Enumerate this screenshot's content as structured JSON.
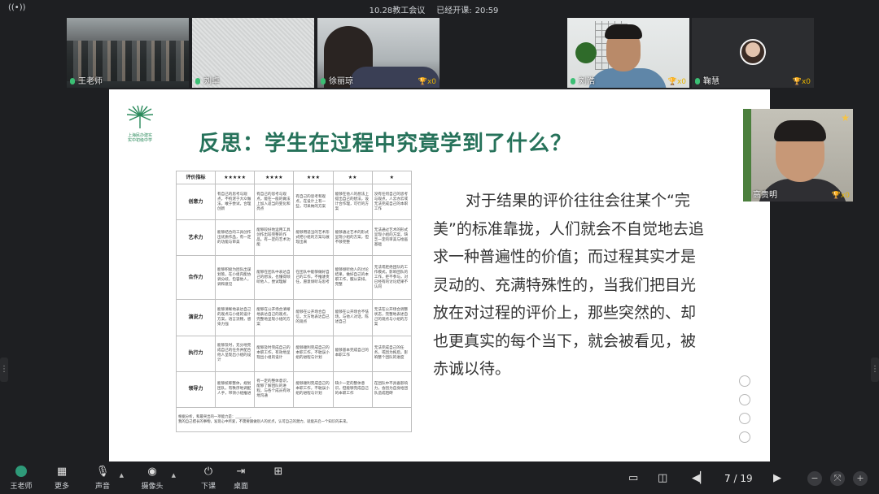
{
  "topbar": {
    "signal_icon": "((•))",
    "meeting_title": "10.28教工会议",
    "status_label": "已经开课:",
    "elapsed": "20:59"
  },
  "tiles": [
    {
      "name": "王老师",
      "cup": ""
    },
    {
      "name": "刘卓",
      "cup": ""
    },
    {
      "name": "徐丽琼",
      "cup": "🏆x0"
    },
    {
      "name": "刘浩",
      "cup": "🏆x0"
    },
    {
      "name": "鞠慧",
      "cup": "🏆x0"
    }
  ],
  "self_video": {
    "name": "高贵明",
    "cup": "🏆x0",
    "star": "★"
  },
  "slide": {
    "logo_text": [
      "上海民办建实",
      "实中初级中学"
    ],
    "heading": "反思：学生在过程中究竟学到了什么？",
    "rubric": {
      "headers": [
        "评价指标",
        "★★★★★",
        "★★★★",
        "★★★",
        "★★",
        "★"
      ],
      "rows": [
        {
          "dim": "创意力",
          "cells": [
            "有自己的思考与观点，不拘泥于大众做法，敢于尝试，合理创新",
            "有自己的思考与观点，能在一般的做法上加入适当的变化和亮点",
            "有自己的思考和观点，在设计上有一些，可采纳的方案",
            "能够在他人的想法上提出自己的想法，设计合作理，可行的方案",
            "没有任何自己的思考与观点，人云亦云或无法完成自己的本职工作"
          ]
        },
        {
          "dim": "艺术力",
          "cells": [
            "能够结合的工具创作出优质作品，有一定的功能与审美",
            "能够较好地运用工具创作出较完整的作品，有一定的艺术功能",
            "能够用适当的艺术形式把小组的方案与展现出来",
            "能够通过艺术的形式呈现小组的方案，但不够完整",
            "无法通过艺术的形式呈现小组的方案，缺乏一定的审美与绘画基础"
          ]
        },
        {
          "dim": "合作力",
          "cells": [
            "能够积极为团队出谋划策，在小组内能协调分歧，包容他人，调和意见",
            "能够在团队中表达自己的想法，也懂得倾听他人，尝试理解",
            "在团队中能够做好自己的工作，不推诿责任，愿意倾听与思考",
            "能够倾听他人的讨论结果，做好自己的本职工作，服从安排，完整",
            "无法或拒绝团队的工作模式，影响团队的工作，拒不参与，对已经有的讨论结果不认同"
          ]
        },
        {
          "dim": "演说力",
          "cells": [
            "能够清晰地表达自己的观点与小组的设计方案，语言流畅，感染力强",
            "能够在公开场合清晰地表达自己的观点，完整地呈现小组的方案",
            "能够在公开场合自信，大方地表达自己的观点",
            "能够在公开场合不怯场，与他人对话，陈述自己",
            "无法在公开场合调整状态，完整地表述自己的观点与小组的方案"
          ]
        },
        {
          "dim": "执行力",
          "cells": [
            "能够及时，充分地完成自己的任务并配合他人呈现出小组的设计",
            "能够及时完成自己的本职工作，有效地呈现出小组的设计",
            "能够顺利完成自己的本职工作，不耽误小组的进程与计划",
            "能够基本完成自己的本职工作",
            "无法完成自己的任务，或因为拖后，影响整个团队的进度"
          ]
        },
        {
          "dim": "领导力",
          "cells": [
            "能够统筹整体，规划团队，有秩序地调配人手，带领小组推进",
            "有一定的整体意识，能够了解团队的进程，与各个成员有效地沟通",
            "能够顺利完成自己的本职工作，不耽误小组的进程与计划",
            "缺少一定的整体意识，但能够完成自己的本职工作",
            "在团队中不具备影响力，会因为自身给团队造成阻碍"
          ]
        }
      ],
      "footer": [
        "根据分析，和最突出的一项能力是：________。",
        "我的自己擅长的事物，发现心中所爱，不需要跟做别人的优点，认可自己的潜力，就能开启一个知识的未来。"
      ]
    },
    "paragraph": "对于结果的评价往往会往某个“完美”的标准靠拢，人们就会不自觉地去追求一种普遍性的价值；而过程其实才是灵动的、充满特殊性的，当我们把目光放在对过程的评价上，那些突然的、却也更真实的每个当下，就会被看见，被赤诚以待。"
  },
  "toolbar": {
    "user_label": "王老师",
    "more_label": "更多",
    "sound_label": "声音",
    "camera_label": "摄像头",
    "leave_label": "下课",
    "desktop_label": "桌面",
    "page_current": "7",
    "page_sep": "/",
    "page_total": "19"
  }
}
